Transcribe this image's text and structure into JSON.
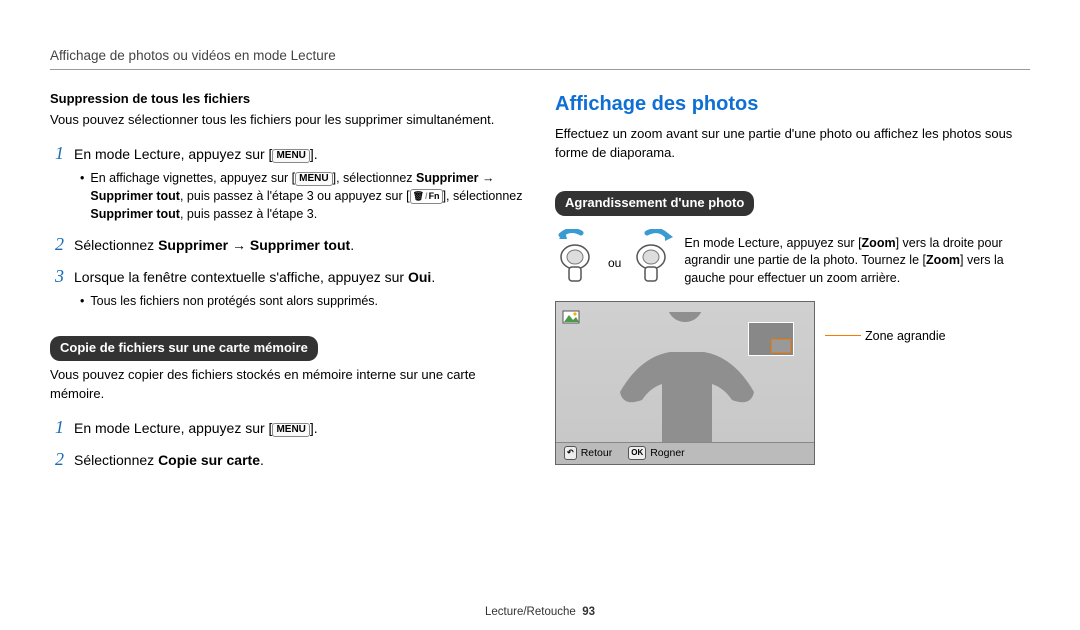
{
  "header": {
    "breadcrumb": "Affichage de photos ou vidéos en mode Lecture"
  },
  "left": {
    "sup_heading": "Suppression de tous les fichiers",
    "sup_intro": "Vous pouvez sélectionner tous les fichiers pour les supprimer simultanément.",
    "menu_btn": "MENU",
    "steps_a": {
      "s1_pre": "En mode Lecture, appuyez sur [",
      "s1_post": "].",
      "s1_sub_pre": "En affichage vignettes, appuyez sur [",
      "s1_sub_mid1": "], sélectionnez ",
      "s1_sub_supprimer": "Supprimer",
      "s1_sub_arrow": " → ",
      "s1_sub_suptout1": "Supprimer tout",
      "s1_sub_mid2": ", puis passez à l'étape 3 ou appuyez sur [",
      "s1_sub_trash": "🗑",
      "s1_sub_slash": "/",
      "s1_sub_fn": "Fn",
      "s1_sub_mid3": "], sélectionnez ",
      "s1_sub_suptout2": "Supprimer tout",
      "s1_sub_end": ", puis passez à l'étape 3.",
      "s2_pre": "Sélectionnez ",
      "s2_b1": "Supprimer",
      "s2_arrow": " → ",
      "s2_b2": "Supprimer tout",
      "s2_post": ".",
      "s3_pre": "Lorsque la fenêtre contextuelle s'affiche, appuyez sur ",
      "s3_b": "Oui",
      "s3_post": ".",
      "s3_sub": "Tous les fichiers non protégés sont alors supprimés."
    },
    "copy_badge": "Copie de fichiers sur une carte mémoire",
    "copy_intro": "Vous pouvez copier des fichiers stockés en mémoire interne sur une carte mémoire.",
    "steps_b": {
      "s1_pre": "En mode Lecture, appuyez sur [",
      "s1_post": "].",
      "s2_pre": "Sélectionnez ",
      "s2_b": "Copie sur carte",
      "s2_post": "."
    }
  },
  "right": {
    "title": "Affichage des photos",
    "intro": "Effectuez un zoom avant sur une partie d'une photo ou affichez les photos sous forme de diaporama.",
    "zoom_badge": "Agrandissement d'une photo",
    "ou": "ou",
    "zoom_desc_pre": "En mode Lecture, appuyez sur [",
    "zoom_b1": "Zoom",
    "zoom_desc_mid1": "] vers la droite pour agrandir une partie de la photo. Tournez le [",
    "zoom_b2": "Zoom",
    "zoom_desc_post": "] vers la gauche pour effectuer un zoom arrière.",
    "callout": "Zone agrandie",
    "preview_bar": {
      "retour_icon": "↶",
      "retour": "Retour",
      "rogner_icon": "OK",
      "rogner": "Rogner"
    }
  },
  "footer": {
    "section": "Lecture/Retouche",
    "page": "93"
  }
}
